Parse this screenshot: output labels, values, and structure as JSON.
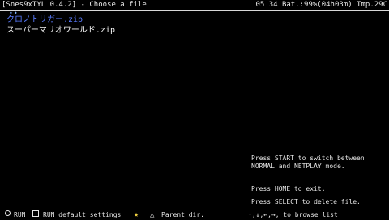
{
  "header": {
    "title": "[Snes9xTYL 0.4.2] - Choose a file",
    "status": "05 34 Bat.:99%(04h03m) Tmp.29C"
  },
  "file_list": {
    "items": [
      {
        "name": "クロノトリガー.zip",
        "selected": true
      },
      {
        "name": "スーパーマリオワールド.zip",
        "selected": false
      }
    ],
    "cursor_glyph": "••"
  },
  "help": {
    "line1": "Press START to switch between",
    "line2": "NORMAL and NETPLAY mode.",
    "line3": "Press HOME to exit.",
    "line4": "Press SELECT to delete file."
  },
  "footer": {
    "run_label": "RUN",
    "run_default_label": "RUN default settings",
    "parent_label": "Parent dir.",
    "browse_label": "↑,↓,←,→, to browse list",
    "icons": [
      "circle-button-icon",
      "square-button-icon",
      "star-icon",
      "triangle-button-icon"
    ]
  },
  "colors": {
    "background": "#000000",
    "selected_file": "#5a7cff",
    "text": "#e6e6e6"
  }
}
